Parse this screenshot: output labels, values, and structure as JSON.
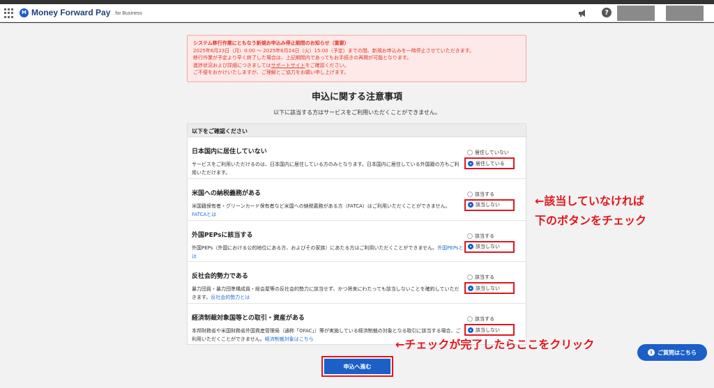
{
  "header": {
    "logo_mark": "M",
    "logo_text": "Money Forward Pay",
    "logo_sub": "for Business",
    "help_glyph": "?"
  },
  "notice": {
    "title": "システム移行作業にともなう新規お申込み停止期間のお知らせ（重要）",
    "line1": "2025年6月23日（月）0:00 〜 2025年6月24日（火）15:00（予定）までの間、新規お申込みを一時停止させていただきます。",
    "line2": "移行作業が予定より早く終了した場合は、上記期間内であってもお手続きの再開が可能となります。",
    "line3_pre": "進捗状況および詳細につきましては",
    "line3_link": "サポートサイト",
    "line3_post": "をご確認ください。",
    "line4": "ご不便をおかけいたしますが、ご理解とご協力をお願い申し上げます。"
  },
  "page": {
    "title": "申込に関する注意事項",
    "subtitle": "以下に該当する方はサービスをご利用いただくことができません。"
  },
  "card": {
    "heading": "以下をご確認ください",
    "items": [
      {
        "title": "日本国内に居住していない",
        "desc": "サービスをご利用いただけるのは、日本国内に居住している方のみとなります。日本国内に居住している外国籍の方もご利用いただけます。",
        "link": "",
        "opt1": "居住していない",
        "opt2": "居住している"
      },
      {
        "title": "米国への納税義務がある",
        "desc": "米国籍保有者・グリーンカード保有者など米国への納税義務がある方（FATCA）はご利用いただくことができません。",
        "link": "FATCAとは",
        "opt1": "該当する",
        "opt2": "該当しない"
      },
      {
        "title": "外国PEPsに該当する",
        "desc": "外国PEPs（外国における公的地位にある方、およびその家族）にあたる方はご利用いただくことができません。",
        "link": "外国PEPsとは",
        "opt1": "該当する",
        "opt2": "該当しない"
      },
      {
        "title": "反社会的勢力である",
        "desc": "暴力団員・暴力団準構成員・総会屋等の反社会的勢力に該当せず、かつ将来にわたっても該当しないことを確約していただきます。",
        "link": "反社会的勢力とは",
        "opt1": "該当する",
        "opt2": "該当しない"
      },
      {
        "title": "経済制裁対象国等との取引・資産がある",
        "desc": "本邦財務省や米国財務省外国資産管理局（通称「OFAC」）等が実施している経済制裁の対象となる取引に該当する場合、ご利用いただくことができません。",
        "link": "経済制裁対象はこちら",
        "opt1": "該当する",
        "opt2": "該当しない"
      }
    ]
  },
  "submit_label": "申込へ進む",
  "annotations": {
    "side_line1": "←該当していなければ",
    "side_line2": "下のボタンをチェック",
    "bottom": "←チェックが完了したらここをクリック"
  },
  "faq_label": "ご質問はこちら",
  "colors": {
    "accent": "#1b5fc7",
    "highlight": "#e2151d",
    "notice_bg": "#fde9e7"
  }
}
